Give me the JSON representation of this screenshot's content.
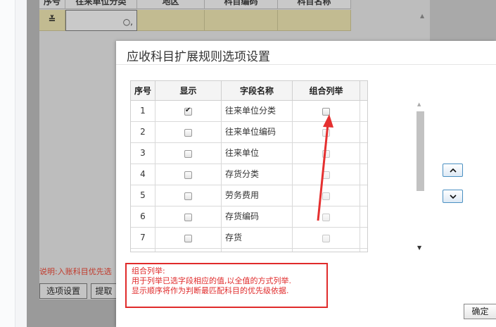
{
  "background": {
    "grid_headers": [
      "序号",
      "往来单位分类",
      "地区",
      "科目编码",
      "科目名称"
    ],
    "row_icon": "≚",
    "note": "说明:入账科目优先选",
    "buttons": [
      "选项设置",
      "提取"
    ]
  },
  "dialog": {
    "title": "应收科目扩展规则选项设置",
    "columns": [
      "序号",
      "显示",
      "字段名称",
      "组合列举"
    ],
    "rows": [
      {
        "idx": "1",
        "name": "往来单位分类",
        "show": true
      },
      {
        "idx": "2",
        "name": "往来单位编码",
        "show": false
      },
      {
        "idx": "3",
        "name": "往来单位",
        "show": false
      },
      {
        "idx": "4",
        "name": "存货分类",
        "show": false
      },
      {
        "idx": "5",
        "name": "劳务费用",
        "show": false
      },
      {
        "idx": "6",
        "name": "存货编码",
        "show": false
      },
      {
        "idx": "7",
        "name": "存货",
        "show": false
      }
    ],
    "note": {
      "line1": "组合列举:",
      "line2": "用于列举已选字段相应的值,以全值的方式列举.",
      "line3": "显示顺序将作为判断最匹配科目的优先级依据."
    },
    "move_up_icon": "chevron-up-icon",
    "move_down_icon": "chevron-down-icon",
    "ok_label": "确定"
  },
  "colors": {
    "annotation": "#e02b2b",
    "button_border": "#4a90c2",
    "row_highlight": "#c2bb91"
  }
}
